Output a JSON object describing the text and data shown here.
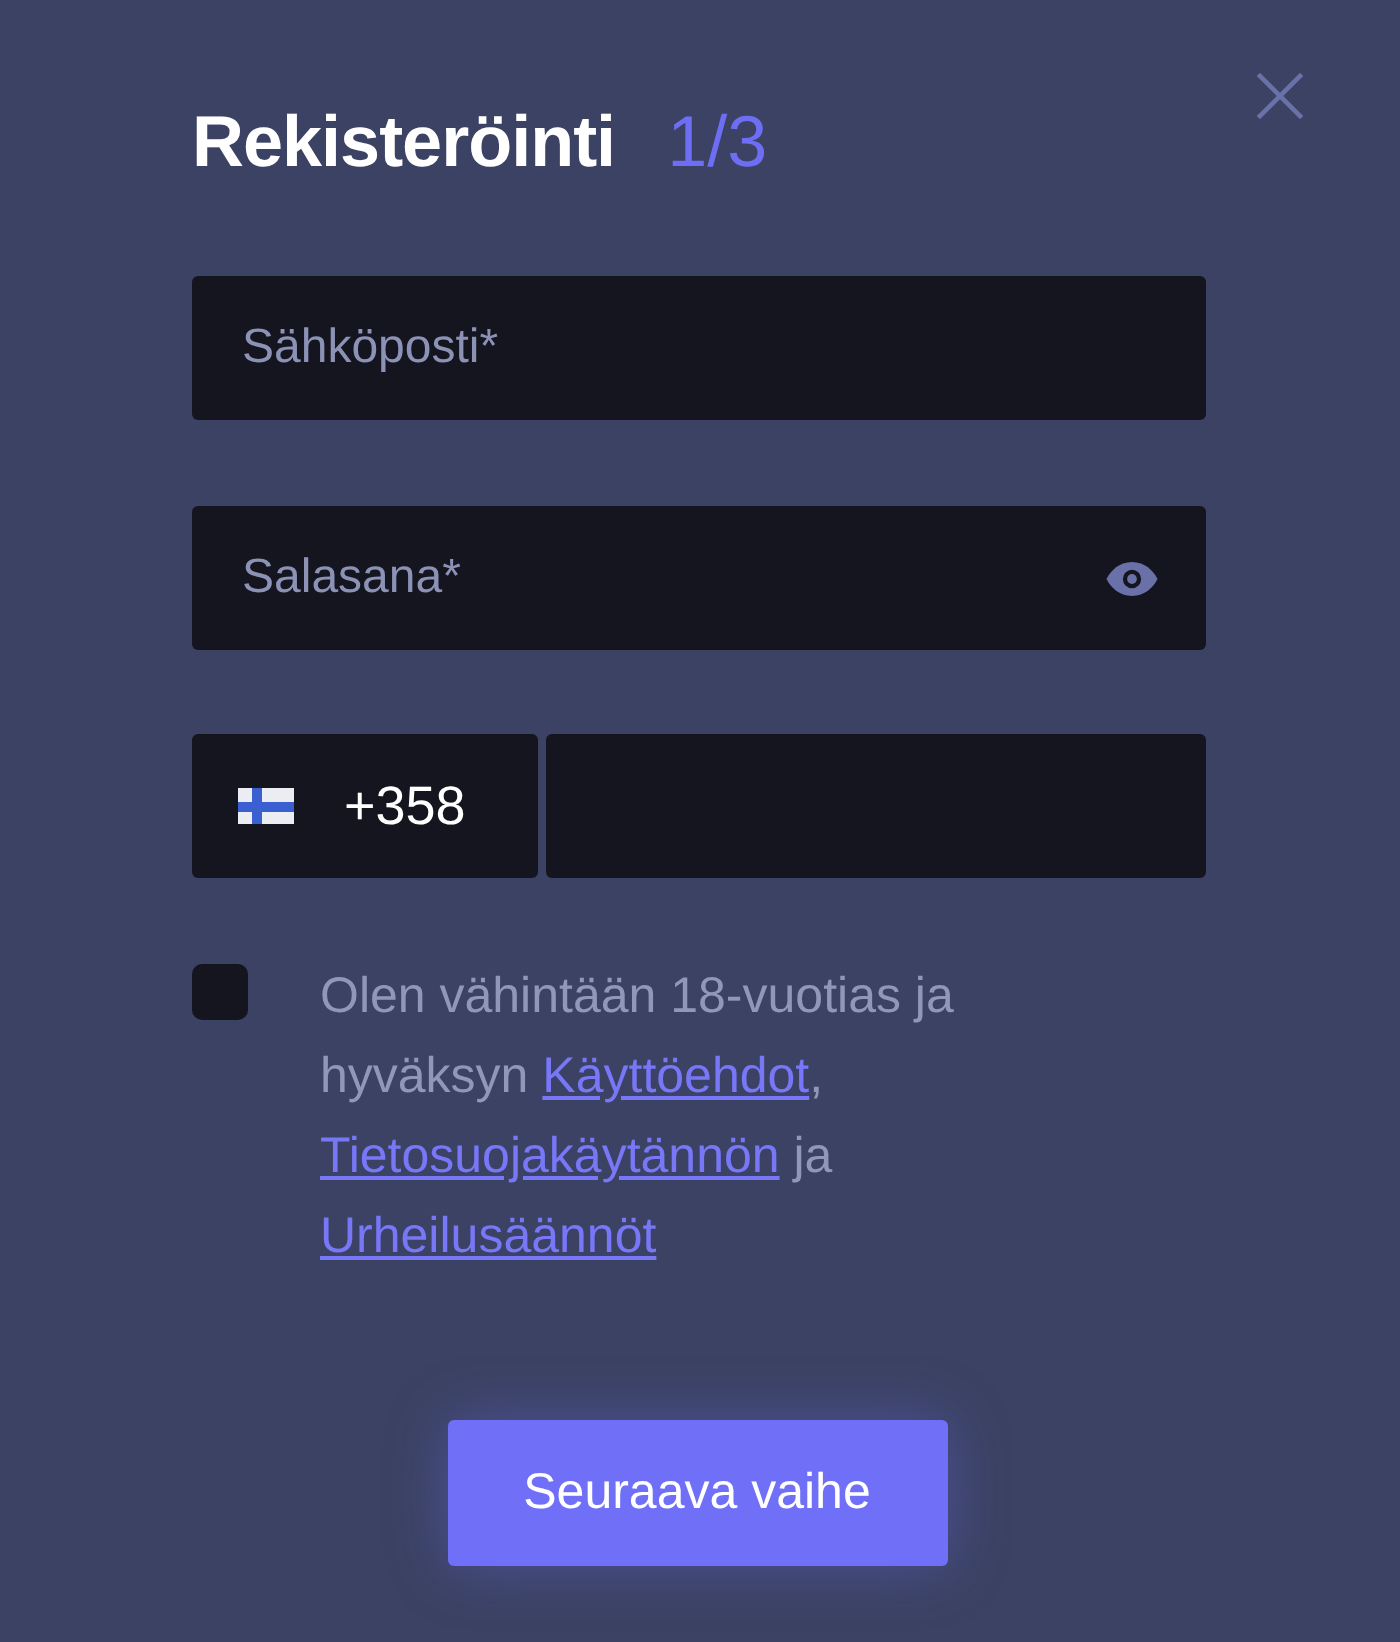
{
  "title": "Rekisteröinti",
  "step": "1/3",
  "email": {
    "placeholder": "Sähköposti*"
  },
  "password": {
    "placeholder": "Salasana*"
  },
  "phone": {
    "country_code": "+358"
  },
  "consent": {
    "checked": false,
    "parts": [
      {
        "kind": "text",
        "text": "Olen vähintään 18-vuotias ja hyväksyn "
      },
      {
        "kind": "link",
        "text": "Käyttöehdot"
      },
      {
        "kind": "text",
        "text": ", "
      },
      {
        "kind": "link",
        "text": "Tietosuojakäytännön"
      },
      {
        "kind": "text",
        "text": " ja "
      },
      {
        "kind": "link",
        "text": "Urheilusäännöt"
      }
    ]
  },
  "next_button": "Seuraava vaihe"
}
